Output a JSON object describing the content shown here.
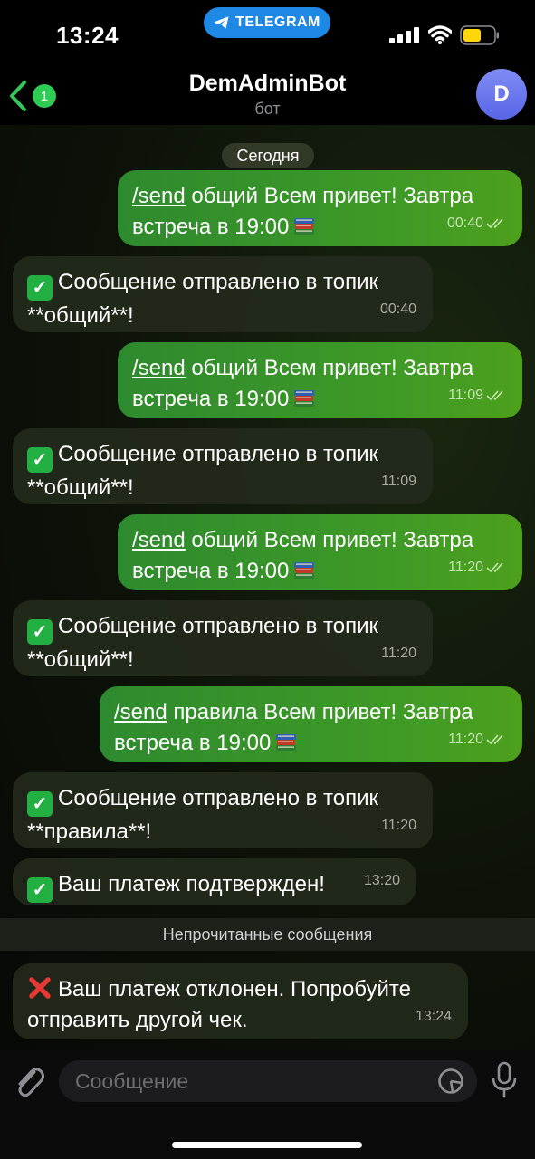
{
  "status_bar": {
    "time": "13:24",
    "pill_label": "TELEGRAM"
  },
  "header": {
    "back_badge": "1",
    "title": "DemAdminBot",
    "subtitle": "бот",
    "avatar_letter": "D"
  },
  "date_separator": "Сегодня",
  "unread_separator": "Непрочитанные сообщения",
  "messages": [
    {
      "dir": "out",
      "command": "/send",
      "line1": " общий Всем привет! Завтра",
      "line2": "встреча в 19:00",
      "emoji": "books",
      "time": "00:40"
    },
    {
      "dir": "in",
      "emoji": "check",
      "line1": "Сообщение отправлено в топик",
      "line2": "**общий**!",
      "time": "00:40"
    },
    {
      "dir": "out",
      "command": "/send",
      "line1": " общий Всем привет! Завтра",
      "line2": "встреча в 19:00",
      "emoji": "books",
      "time": "11:09"
    },
    {
      "dir": "in",
      "emoji": "check",
      "line1": "Сообщение отправлено в топик",
      "line2": "**общий**!",
      "time": "11:09"
    },
    {
      "dir": "out",
      "command": "/send",
      "line1": " общий Всем привет! Завтра",
      "line2": "встреча в 19:00",
      "emoji": "books",
      "time": "11:20"
    },
    {
      "dir": "in",
      "emoji": "check",
      "line1": "Сообщение отправлено в топик",
      "line2": "**общий**!",
      "time": "11:20"
    },
    {
      "dir": "out",
      "command": "/send",
      "line1": " правила Всем привет! Завтра",
      "line2": "встреча в 19:00",
      "emoji": "books",
      "time": "11:20"
    },
    {
      "dir": "in",
      "emoji": "check",
      "line1": "Сообщение отправлено в топик",
      "line2": "**правила**!",
      "time": "11:20"
    },
    {
      "dir": "in",
      "emoji": "check",
      "line1": "Ваш платеж подтвержден!",
      "time": "13:20"
    },
    {
      "dir": "in",
      "emoji": "cross",
      "line1": "Ваш платеж отклонен. Попробуйте",
      "line2": "отправить другой чек.",
      "time": "13:24"
    }
  ],
  "input": {
    "placeholder": "Сообщение"
  },
  "colors": {
    "outgoing_bubble": "#3a9428",
    "incoming_bubble": "#222a1c",
    "pill_blue": "#1e88e5",
    "avatar": "#6a78ef",
    "badge": "#2ecc55"
  },
  "icons": [
    "telegram-plane-icon",
    "signal-icon",
    "wifi-icon",
    "battery-icon",
    "back-chevron-icon",
    "check-mark-emoji",
    "cross-mark-emoji",
    "books-emoji",
    "double-check-icon",
    "paperclip-icon",
    "sticker-icon",
    "microphone-icon"
  ]
}
